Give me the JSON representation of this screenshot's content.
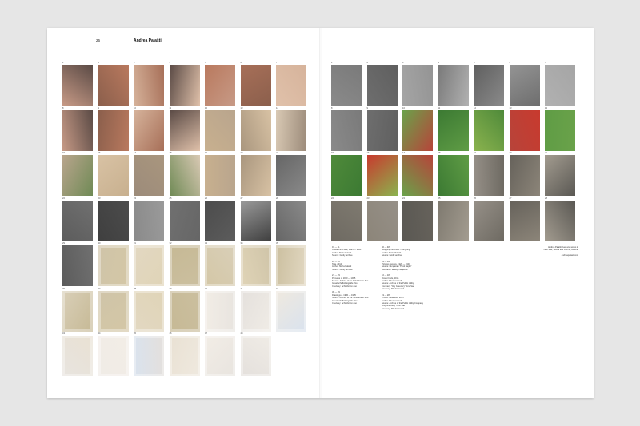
{
  "page": {
    "folio": "26",
    "author": "Andrea Palašti"
  },
  "left_grid": {
    "cols": 7,
    "items": [
      {
        "n": "1",
        "tone": "portrait"
      },
      {
        "n": "2",
        "tone": "portrait"
      },
      {
        "n": "3",
        "tone": "portrait"
      },
      {
        "n": "4",
        "tone": "portrait"
      },
      {
        "n": "5",
        "tone": "portrait"
      },
      {
        "n": "6",
        "tone": "portrait"
      },
      {
        "n": "7",
        "tone": "portrait"
      },
      {
        "n": "8",
        "tone": "portrait"
      },
      {
        "n": "9",
        "tone": "portrait"
      },
      {
        "n": "10",
        "tone": "portrait"
      },
      {
        "n": "11",
        "tone": "portrait"
      },
      {
        "n": "12",
        "tone": "interior"
      },
      {
        "n": "13",
        "tone": "interior"
      },
      {
        "n": "14",
        "tone": "interior"
      },
      {
        "n": "15",
        "tone": "interior"
      },
      {
        "n": "16",
        "tone": "interior"
      },
      {
        "n": "17",
        "tone": "interior"
      },
      {
        "n": "18",
        "tone": "interior"
      },
      {
        "n": "19",
        "tone": "interior"
      },
      {
        "n": "20",
        "tone": "interior"
      },
      {
        "n": "21",
        "tone": "monkey"
      },
      {
        "n": "22",
        "tone": "monkey"
      },
      {
        "n": "23",
        "tone": "monkey"
      },
      {
        "n": "24",
        "tone": "monkey"
      },
      {
        "n": "25",
        "tone": "monkey"
      },
      {
        "n": "26",
        "tone": "monkey"
      },
      {
        "n": "27",
        "tone": "monkey"
      },
      {
        "n": "28",
        "tone": "monkey"
      },
      {
        "n": "29",
        "tone": "monkey"
      },
      {
        "n": "30",
        "tone": "drawing"
      },
      {
        "n": "31",
        "tone": "drawing"
      },
      {
        "n": "32",
        "tone": "drawing"
      },
      {
        "n": "33",
        "tone": "drawing"
      },
      {
        "n": "34",
        "tone": "drawing"
      },
      {
        "n": "35",
        "tone": "drawing"
      },
      {
        "n": "36",
        "tone": "drawing"
      },
      {
        "n": "37",
        "tone": "drawing"
      },
      {
        "n": "38",
        "tone": "drawing"
      },
      {
        "n": "39",
        "tone": "drawing"
      },
      {
        "n": "40",
        "tone": "package"
      },
      {
        "n": "41",
        "tone": "package"
      },
      {
        "n": "42",
        "tone": "package"
      },
      {
        "n": "43",
        "tone": "package"
      },
      {
        "n": "44",
        "tone": "package"
      },
      {
        "n": "45",
        "tone": "package"
      },
      {
        "n": "46",
        "tone": "package"
      },
      {
        "n": "47",
        "tone": "package"
      },
      {
        "n": "48",
        "tone": "package"
      }
    ]
  },
  "right_grid": {
    "cols": 7,
    "items": [
      {
        "n": "1",
        "tone": "archive"
      },
      {
        "n": "2",
        "tone": "archive"
      },
      {
        "n": "3",
        "tone": "archive"
      },
      {
        "n": "4",
        "tone": "archive"
      },
      {
        "n": "5",
        "tone": "archive"
      },
      {
        "n": "6",
        "tone": "archive"
      },
      {
        "n": "7",
        "tone": "archive"
      },
      {
        "n": "8",
        "tone": "archive"
      },
      {
        "n": "9",
        "tone": "archive"
      },
      {
        "n": "10",
        "tone": "garden"
      },
      {
        "n": "11",
        "tone": "garden"
      },
      {
        "n": "12",
        "tone": "garden"
      },
      {
        "n": "13",
        "tone": "garden"
      },
      {
        "n": "14",
        "tone": "garden"
      },
      {
        "n": "15",
        "tone": "garden"
      },
      {
        "n": "16",
        "tone": "garden"
      },
      {
        "n": "17",
        "tone": "garden"
      },
      {
        "n": "18",
        "tone": "garden"
      },
      {
        "n": "19",
        "tone": "street"
      },
      {
        "n": "20",
        "tone": "street"
      },
      {
        "n": "21",
        "tone": "street"
      },
      {
        "n": "22",
        "tone": "street"
      },
      {
        "n": "23",
        "tone": "street"
      },
      {
        "n": "24",
        "tone": "street"
      },
      {
        "n": "25",
        "tone": "street"
      },
      {
        "n": "26",
        "tone": "street"
      },
      {
        "n": "27",
        "tone": "street"
      },
      {
        "n": "28",
        "tone": "street"
      }
    ]
  },
  "captions": {
    "col1": [
      [
        "01 — 11",
        "Untitled and fake, 1995 — 2001",
        "Author: Marta Palašti",
        "Source: family archive"
      ],
      [
        "12 — 20",
        "Tata, 2012",
        "Author: Marta Palašti",
        "Source: family archive"
      ],
      [
        "21 — 29",
        "Primates c. 1930 — 1935",
        "Source: Archive of the Schönbrunn Zoo",
        "Gesellschaftsfotografie Zoo",
        "Courtesy: Schönbrunn Zoo"
      ],
      [
        "30 — 39",
        "Drawings c. 1930 — 1935",
        "Source: Archive of the Schönbrunn Zoo",
        "Gesellschaftsfotografie Zoo",
        "Courtesy: Schönbrunn Zoo"
      ]
    ],
    "col2": [
      [
        "40 — 48",
        "Shopping list, 2016 — ongoing",
        "Author: Marta Palašti",
        "Source: family archive"
      ],
      [
        "01 — 09",
        "Pictures Sunday, 1920 — 1934",
        "Source: Hungarian \"Pesti Napló\"",
        "Hungarian weekly magazine"
      ],
      [
        "10 — 18",
        "Flower beds, 2015",
        "Author: Rita Kenwood",
        "Source: Archive of the Public Utility",
        "Company \"City Greenery\" Novi Sad",
        "Courtesy: Rita Kenwood"
      ],
      [
        "19 — 28",
        "Trunks: Instances, 2015",
        "Author: Rita Kenwood",
        "Source: Archive of the Public Utility Company",
        "\"City Greenery\" Novi Sad",
        "Courtesy: Rita Kenwood"
      ]
    ]
  },
  "credit": [
    "Andrea Palašti lives and works in",
    "Novi Sad, Serbia and Vienna, Austria.",
    "",
    "andreapalasti.com"
  ],
  "colors": {
    "page_bg": "#e6e6e6",
    "paper": "#ffffff",
    "text": "#111111"
  }
}
